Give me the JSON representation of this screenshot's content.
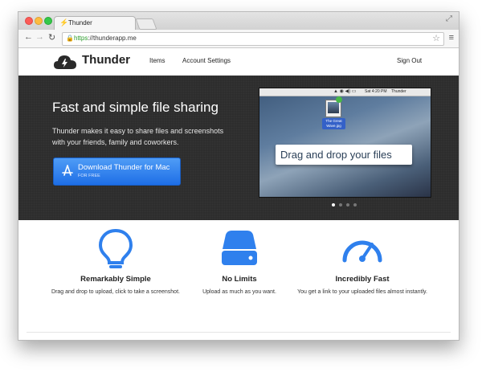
{
  "browser": {
    "tab_title": "Thunder",
    "url_scheme": "https",
    "url_rest": "://thunderapp.me"
  },
  "site": {
    "brand": "Thunder",
    "nav": [
      "Items",
      "Account Settings"
    ],
    "sign_out": "Sign Out"
  },
  "hero": {
    "title": "Fast and simple file sharing",
    "subtitle": "Thunder makes it easy to share files and screenshots with your friends, family and coworkers.",
    "download_label": "Download Thunder for Mac",
    "download_sub": "FOR FREE"
  },
  "screenshot": {
    "menubar_time": "Sat 4:20 PM",
    "menubar_app": "Thunder",
    "file_label": "The Great Wave.jpg",
    "drag_text": "Drag and drop your files"
  },
  "carousel": {
    "count": 4,
    "active_index": 0
  },
  "features": [
    {
      "title": "Remarkably Simple",
      "desc": "Drag and drop to upload, click to take a screenshot.",
      "icon": "lightbulb-icon"
    },
    {
      "title": "No Limits",
      "desc": "Upload as much as you want.",
      "icon": "drive-icon"
    },
    {
      "title": "Incredibly Fast",
      "desc": "You get a link to your uploaded files almost instantly.",
      "icon": "speedometer-icon"
    }
  ],
  "colors": {
    "accent": "#2f80ed",
    "hero_bg": "#2d2d2d",
    "download_button": "#2b7bf0"
  }
}
